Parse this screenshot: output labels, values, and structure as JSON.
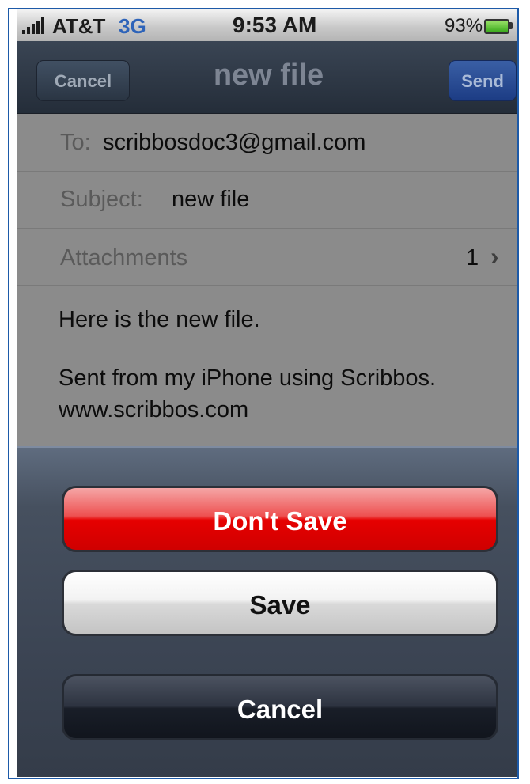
{
  "status_bar": {
    "carrier": "AT&T",
    "network": "3G",
    "time": "9:53 AM",
    "battery_percent": "93%"
  },
  "nav": {
    "title": "new file",
    "cancel_label": "Cancel",
    "send_label": "Send"
  },
  "mail": {
    "to_label": "To:",
    "to_value": "scribbosdoc3@gmail.com",
    "subject_label": "Subject:",
    "subject_value": "new file",
    "attachments_label": "Attachments",
    "attachments_count": "1",
    "body_line1": "Here is the new file.",
    "body_line2": "Sent from my iPhone using Scribbos.",
    "body_line3": "www.scribbos.com"
  },
  "action_sheet": {
    "dont_save_label": "Don't Save",
    "save_label": "Save",
    "cancel_label": "Cancel"
  },
  "colors": {
    "frame_border": "#1d5aa8",
    "destructive": "#e60000",
    "network": "#2d63b9"
  }
}
